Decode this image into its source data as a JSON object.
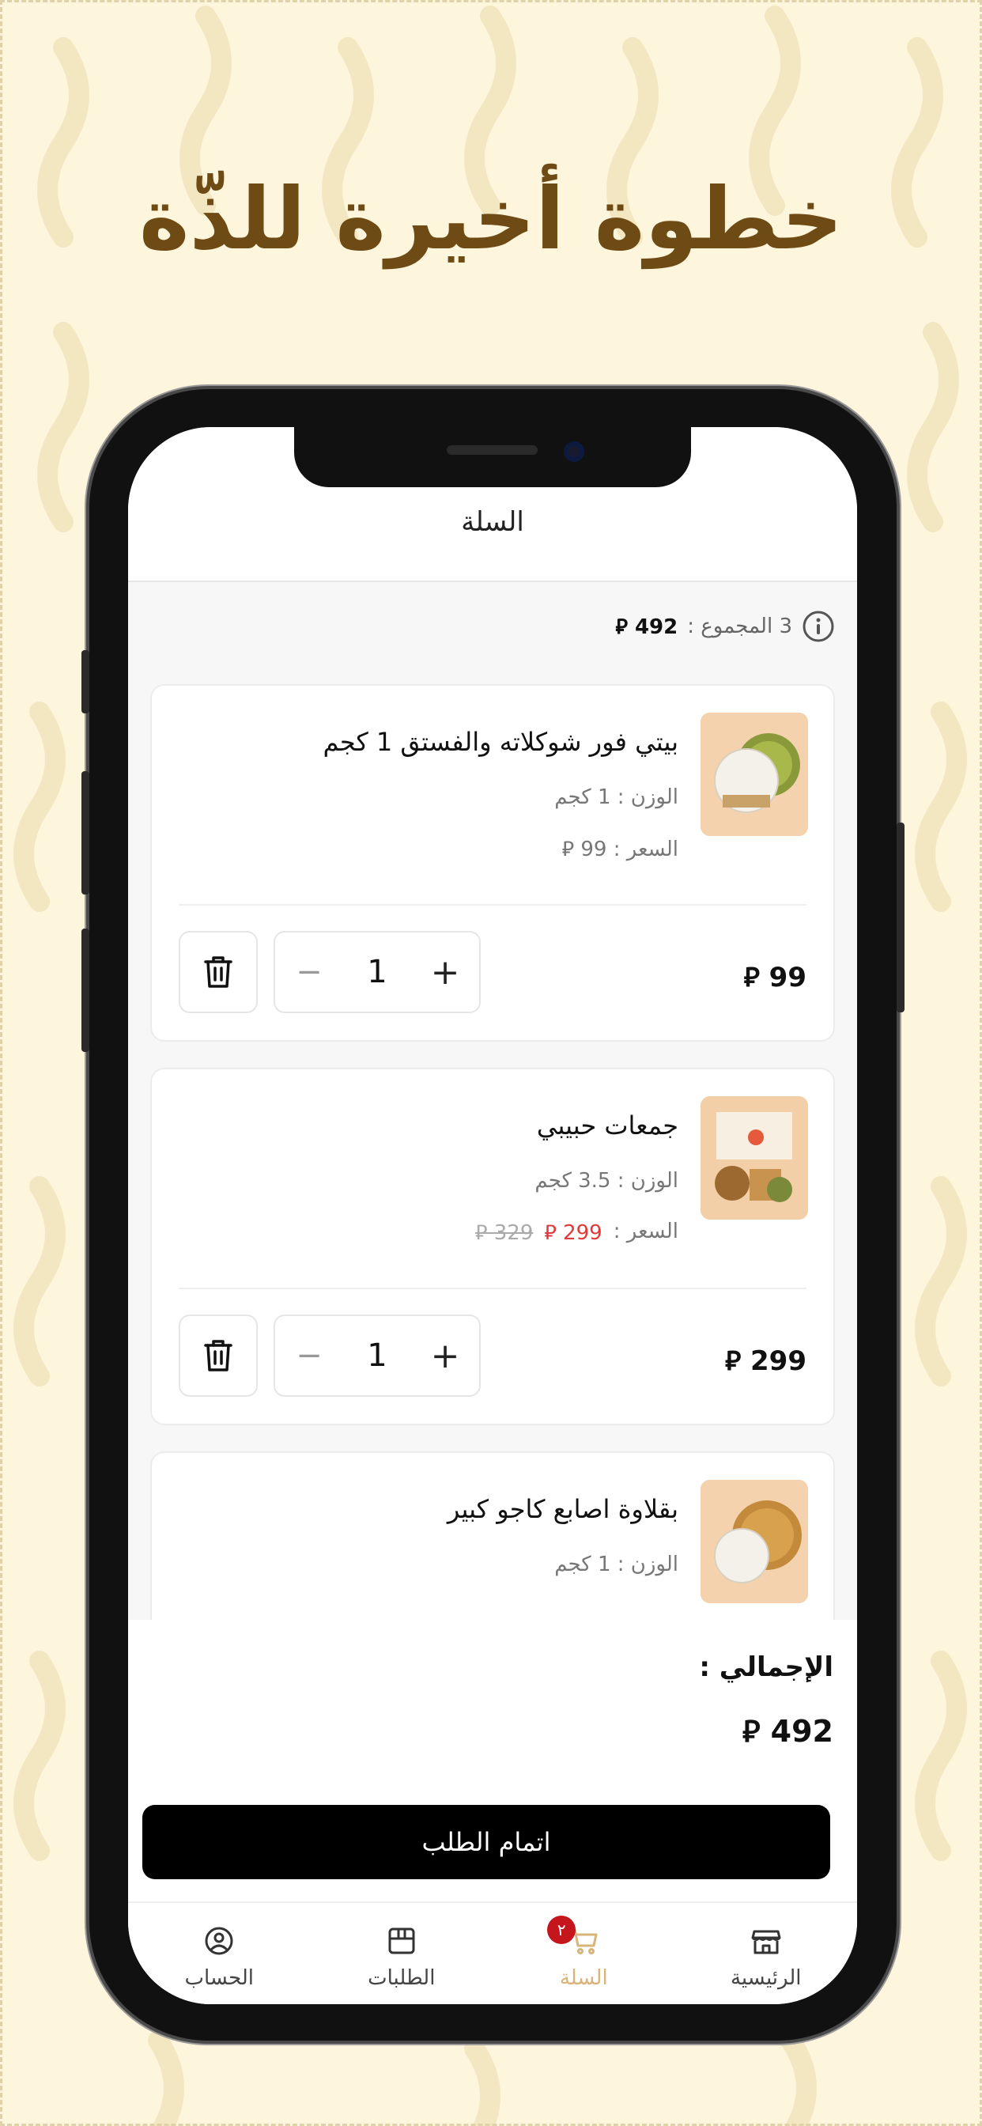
{
  "headline": "خطوة أخيرة للذّة",
  "app": {
    "title": "السلة",
    "summary": {
      "count_label": "3 المجموع :",
      "total": "492 ⃁"
    },
    "items": [
      {
        "name": "بيتي فور شوكلاته والفستق 1 كجم",
        "weight": "الوزن : 1 كجم",
        "price_label": "السعر : 99 ⃁",
        "sale_price": "",
        "old_price": "",
        "quantity": "1",
        "line_total": "99 ⃁"
      },
      {
        "name": "جمعات حبيبي",
        "weight": "الوزن : 3.5 كجم",
        "price_label": "السعر :",
        "sale_price": "299 ⃁",
        "old_price": "329 ⃁",
        "quantity": "1",
        "line_total": "299 ⃁"
      },
      {
        "name": "بقلاوة اصابع كاجو كبير",
        "weight": "الوزن : 1 كجم",
        "price_label": "",
        "sale_price": "",
        "old_price": "",
        "quantity": "",
        "line_total": ""
      }
    ],
    "stepper": {
      "minus": "−",
      "plus": "+"
    },
    "footer": {
      "total_label": "الإجمالي :",
      "total_value": "492 ⃁",
      "checkout": "اتمام الطلب"
    },
    "tabs": [
      {
        "label": "الرئيسية",
        "icon": "store-icon"
      },
      {
        "label": "السلة",
        "icon": "cart-icon",
        "badge": "٢"
      },
      {
        "label": "الطلبات",
        "icon": "box-icon"
      },
      {
        "label": "الحساب",
        "icon": "user-circle-icon"
      }
    ]
  },
  "colors": {
    "background": "#fdf5dc",
    "headline": "#6e4a14",
    "active_tab": "#d9b47a",
    "sale": "#e03a3a",
    "badge": "#c4161c",
    "checkout_bg": "#000000"
  }
}
